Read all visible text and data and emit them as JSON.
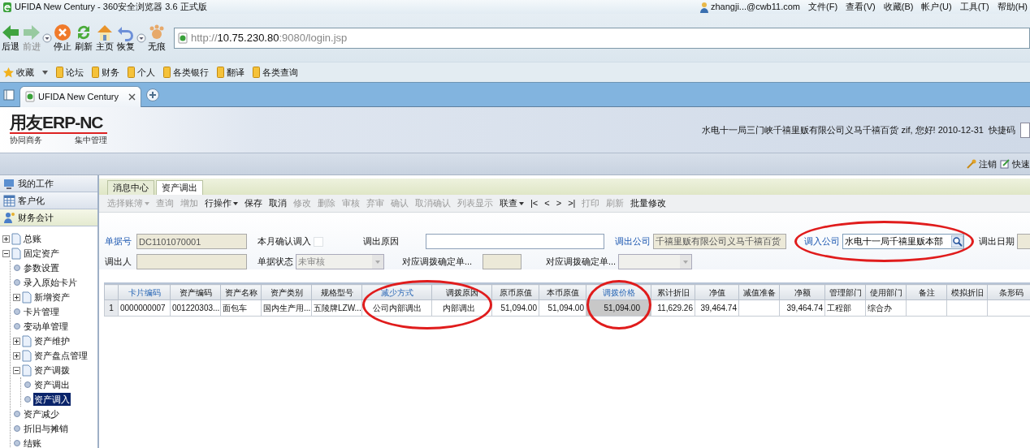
{
  "browser": {
    "title": "UFIDA New Century - 360安全浏览器 3.6 正式版",
    "user": "zhangji...@cwb11.com",
    "menus": [
      "文件(F)",
      "查看(V)",
      "收藏(B)",
      "帐户(U)",
      "工具(T)",
      "帮助(H)"
    ],
    "nav_buttons": [
      {
        "label": "后退",
        "kind": "back",
        "disabled": false,
        "dropdown": false
      },
      {
        "label": "前进",
        "kind": "forward",
        "disabled": true,
        "dropdown": true
      },
      {
        "label": "停止",
        "kind": "stop",
        "disabled": false,
        "dropdown": false
      },
      {
        "label": "刷新",
        "kind": "refresh",
        "disabled": false,
        "dropdown": false
      },
      {
        "label": "主页",
        "kind": "home",
        "disabled": false,
        "dropdown": false
      },
      {
        "label": "恢复",
        "kind": "restore",
        "disabled": false,
        "dropdown": true
      },
      {
        "label": "无痕",
        "kind": "incognito",
        "disabled": false,
        "dropdown": false
      }
    ],
    "address": {
      "scheme": "http://",
      "host": "10.75.230.80",
      "rest": ":9080/login.jsp"
    },
    "bookmarks": [
      {
        "label": "收藏",
        "kind": "favorites"
      },
      {
        "label": "论坛",
        "kind": "folder"
      },
      {
        "label": "财务",
        "kind": "folder"
      },
      {
        "label": "个人",
        "kind": "folder"
      },
      {
        "label": "各类银行",
        "kind": "folder"
      },
      {
        "label": "翻译",
        "kind": "folder"
      },
      {
        "label": "各类查询",
        "kind": "folder"
      }
    ],
    "tabs": [
      {
        "label": "UFIDA New Century",
        "selected": true
      }
    ]
  },
  "app": {
    "logo": {
      "title": "用友ERP-NC",
      "subtitle_left": "协同商务",
      "subtitle_right": "集中管理"
    },
    "greeting": "水电十一局三门峡千禧里贩有限公司义马千禧百货 zif, 您好! 2010-12-31",
    "shortcut_label": "快捷码",
    "actions": [
      {
        "label": "注销",
        "kind": "key"
      },
      {
        "label": "快速",
        "kind": "note"
      }
    ]
  },
  "sidebar": {
    "sections": [
      {
        "label": "我的工作",
        "kind": "computer",
        "selected": false
      },
      {
        "label": "客户化",
        "kind": "grid",
        "selected": false
      },
      {
        "label": "财务会计",
        "kind": "person",
        "selected": true
      }
    ],
    "tree": [
      {
        "label": "总账",
        "kind": "folder",
        "expanded": false,
        "selected": false
      },
      {
        "label": "固定资产",
        "kind": "folder",
        "expanded": true,
        "selected": false,
        "children": [
          {
            "label": "参数设置",
            "kind": "leaf",
            "selected": false
          },
          {
            "label": "录入原始卡片",
            "kind": "leaf",
            "selected": false
          },
          {
            "label": "新增资产",
            "kind": "folder",
            "expanded": false,
            "selected": false
          },
          {
            "label": "卡片管理",
            "kind": "leaf",
            "selected": false
          },
          {
            "label": "变动单管理",
            "kind": "leaf",
            "selected": false
          },
          {
            "label": "资产维护",
            "kind": "folder",
            "expanded": false,
            "selected": false
          },
          {
            "label": "资产盘点管理",
            "kind": "folder",
            "expanded": false,
            "selected": false
          },
          {
            "label": "资产调拨",
            "kind": "folder",
            "expanded": true,
            "selected": false,
            "children": [
              {
                "label": "资产调出",
                "kind": "leaf",
                "selected": false
              },
              {
                "label": "资产调入",
                "kind": "leaf",
                "selected": true
              }
            ]
          },
          {
            "label": "资产减少",
            "kind": "leaf",
            "selected": false
          },
          {
            "label": "折旧与摊销",
            "kind": "leaf",
            "selected": false
          },
          {
            "label": "结账",
            "kind": "leaf",
            "selected": false
          }
        ]
      }
    ]
  },
  "main": {
    "tabs": [
      {
        "label": "消息中心",
        "selected": false
      },
      {
        "label": "资产调出",
        "selected": true
      }
    ],
    "toolbar": [
      {
        "label": "选择账簿",
        "disabled": true,
        "dropdown": true
      },
      {
        "label": "查询",
        "disabled": true,
        "dropdown": false
      },
      {
        "label": "增加",
        "disabled": true,
        "dropdown": false
      },
      {
        "label": "行操作",
        "disabled": false,
        "dropdown": true
      },
      {
        "label": "保存",
        "disabled": false,
        "dropdown": false
      },
      {
        "label": "取消",
        "disabled": false,
        "dropdown": false
      },
      {
        "label": "修改",
        "disabled": true,
        "dropdown": false
      },
      {
        "label": "删除",
        "disabled": true,
        "dropdown": false
      },
      {
        "label": "审核",
        "disabled": true,
        "dropdown": false
      },
      {
        "label": "弃审",
        "disabled": true,
        "dropdown": false
      },
      {
        "label": "确认",
        "disabled": true,
        "dropdown": false
      },
      {
        "label": "取消确认",
        "disabled": true,
        "dropdown": false
      },
      {
        "label": "列表显示",
        "disabled": true,
        "dropdown": false
      },
      {
        "label": "联查",
        "disabled": false,
        "dropdown": true
      },
      {
        "label": "|<",
        "disabled": false,
        "dropdown": false
      },
      {
        "label": "<",
        "disabled": false,
        "dropdown": false
      },
      {
        "label": ">",
        "disabled": false,
        "dropdown": false
      },
      {
        "label": ">|",
        "disabled": false,
        "dropdown": false
      },
      {
        "label": "打印",
        "disabled": true,
        "dropdown": false
      },
      {
        "label": "刷新",
        "disabled": true,
        "dropdown": false
      },
      {
        "label": "批量修改",
        "disabled": false,
        "dropdown": false
      }
    ],
    "form_rows": [
      [
        {
          "label": "单据号",
          "kind": "text",
          "value": "DC1101070001",
          "required": true,
          "disabled": true
        },
        {
          "label": "本月确认调入",
          "kind": "checkbox",
          "checked": false,
          "required": false,
          "disabled": false
        },
        {
          "label": "调出原因",
          "kind": "text",
          "required": false,
          "disabled": false
        },
        {
          "label": "调出公司",
          "kind": "text",
          "value": "千禧里贩有限公司义马千禧百货",
          "required": true,
          "disabled": true
        },
        {
          "label": "调入公司",
          "kind": "lookup",
          "value": "水电十一局千禧里贩本部",
          "required": true,
          "disabled": false,
          "circled": true
        },
        {
          "label": "调出日期",
          "kind": "text",
          "required": false,
          "disabled": true
        }
      ],
      [
        {
          "label": "调出人",
          "kind": "text",
          "required": false,
          "disabled": true
        },
        {
          "label": "单据状态",
          "kind": "select",
          "value": "未审核",
          "required": false,
          "disabled": true
        },
        {
          "label": "对应调拨确定单...",
          "kind": "text",
          "required": false,
          "disabled": true
        },
        {
          "label": "对应调拨确定单...",
          "kind": "select",
          "required": false,
          "disabled": true
        }
      ]
    ],
    "table": {
      "columns": [
        {
          "label": "卡片编码",
          "highlight": true
        },
        {
          "label": "资产编码",
          "highlight": false
        },
        {
          "label": "资产名称",
          "highlight": false
        },
        {
          "label": "资产类别",
          "highlight": false
        },
        {
          "label": "规格型号",
          "highlight": false
        },
        {
          "label": "减少方式",
          "highlight": true,
          "circled": true
        },
        {
          "label": "调拨原因",
          "highlight": false,
          "circled": true
        },
        {
          "label": "原币原值",
          "highlight": false
        },
        {
          "label": "本币原值",
          "highlight": false
        },
        {
          "label": "调拨价格",
          "highlight": true,
          "circled": true
        },
        {
          "label": "累计折旧",
          "highlight": false
        },
        {
          "label": "净值",
          "highlight": false
        },
        {
          "label": "减值准备",
          "highlight": false
        },
        {
          "label": "净额",
          "highlight": false
        },
        {
          "label": "管理部门",
          "highlight": false
        },
        {
          "label": "使用部门",
          "highlight": false
        },
        {
          "label": "备注",
          "highlight": false
        },
        {
          "label": "模拟折旧",
          "highlight": false
        },
        {
          "label": "条形码",
          "highlight": false
        }
      ],
      "rows": [
        {
          "number": "1",
          "cells": [
            {
              "text": "0000000007",
              "kind": "text",
              "selected": false
            },
            {
              "text": "001220303...",
              "kind": "text",
              "selected": false
            },
            {
              "text": "面包车",
              "kind": "text",
              "selected": false
            },
            {
              "text": "国内生产用...",
              "kind": "text",
              "selected": false
            },
            {
              "text": "五陵牌LZW...",
              "kind": "text",
              "selected": false
            },
            {
              "text": "公司内部调出",
              "kind": "text",
              "selected": false
            },
            {
              "text": "内部调出",
              "kind": "text",
              "selected": false
            },
            {
              "text": "51,094.00",
              "kind": "number",
              "selected": false
            },
            {
              "text": "51,094.00",
              "kind": "number",
              "selected": false
            },
            {
              "text": "51,094.00",
              "kind": "number",
              "selected": true
            },
            {
              "text": "11,629.26",
              "kind": "number",
              "selected": false
            },
            {
              "text": "39,464.74",
              "kind": "number",
              "selected": false
            },
            {
              "kind": "number",
              "selected": false
            },
            {
              "text": "39,464.74",
              "kind": "number",
              "selected": false
            },
            {
              "text": "工程部",
              "kind": "text",
              "selected": false
            },
            {
              "text": "综合办",
              "kind": "text",
              "selected": false
            },
            {
              "kind": "text",
              "selected": false
            },
            {
              "kind": "number",
              "selected": false
            },
            {
              "kind": "text",
              "selected": false
            }
          ]
        }
      ]
    }
  }
}
